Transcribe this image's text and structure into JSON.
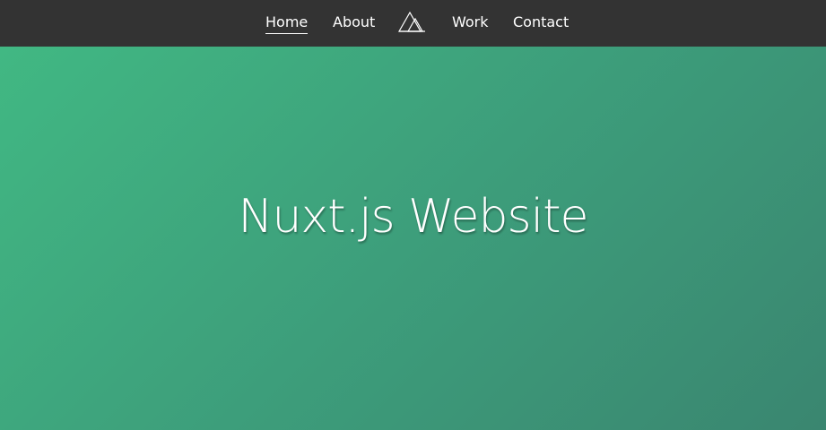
{
  "nav": {
    "items": [
      {
        "label": "Home",
        "active": true
      },
      {
        "label": "About",
        "active": false
      },
      {
        "label": "Work",
        "active": false
      },
      {
        "label": "Contact",
        "active": false
      }
    ],
    "logo_icon": "nuxt-logo-icon",
    "background_color": "#333333",
    "text_color": "#ffffff"
  },
  "hero": {
    "title": "Nuxt.js Website",
    "gradient_colors": [
      "#41b883",
      "#3a8670"
    ]
  }
}
